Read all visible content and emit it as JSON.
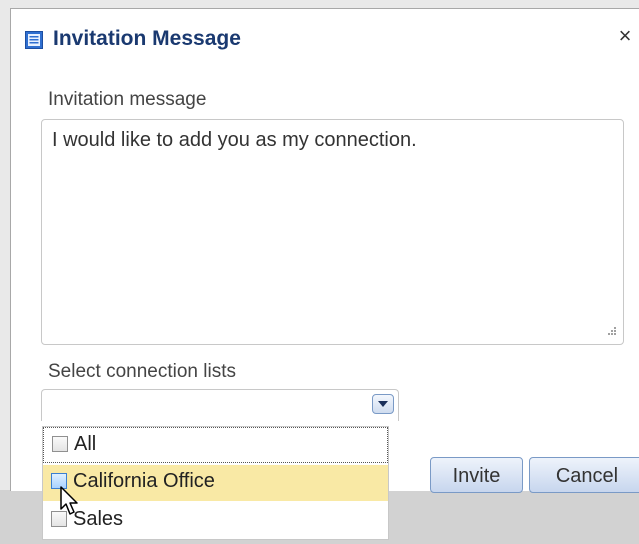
{
  "dialog": {
    "title": "Invitation Message",
    "close_glyph": "×",
    "icon": "document-icon"
  },
  "message": {
    "label": "Invitation message",
    "value": "I would like to add you as my connection."
  },
  "lists": {
    "label": "Select connection lists",
    "selected_value": "",
    "options": [
      {
        "label": "All",
        "checked": false,
        "focused": true
      },
      {
        "label": "California Office",
        "checked": false,
        "hovered": true
      },
      {
        "label": "Sales",
        "checked": false
      }
    ]
  },
  "buttons": {
    "invite": "Invite",
    "cancel": "Cancel"
  },
  "colors": {
    "title": "#1a3970",
    "hover_highlight": "#f9e9a5",
    "button_border": "#7a9ac6"
  }
}
